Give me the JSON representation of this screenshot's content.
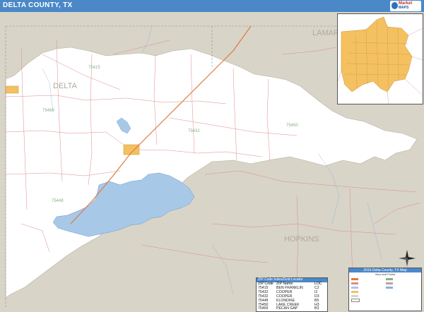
{
  "title": "DELTA COUNTY, TX",
  "logo": {
    "line1": "Market",
    "line2": "MAPS"
  },
  "map_labels": {
    "delta": "DELTA",
    "lamar": "LAMAR",
    "hopkins": "HOPKINS",
    "zip_75415": "75415",
    "zip_75469": "75469",
    "zip_75432": "75432",
    "zip_75450": "75450",
    "zip_75448": "75448"
  },
  "zip_legend": {
    "header": "ZIP Code Index/Grid Locator",
    "columns": [
      "ZIP Code",
      "ZIP Name",
      "LOC"
    ],
    "rows": [
      [
        "75415",
        "BEN FRANKLIN",
        "C2"
      ],
      [
        "75432",
        "COOPER",
        "I2"
      ],
      [
        "75432",
        "COOPER",
        "D3"
      ],
      [
        "75448",
        "KLONDIKE",
        "B5"
      ],
      [
        "75450",
        "LAKE CREEK",
        "H3"
      ],
      [
        "75469",
        "PECAN GAP",
        "B3"
      ]
    ]
  },
  "map_legend": {
    "header": "2016 Delta County, TX Map",
    "subtitle": "View and Points"
  },
  "colors": {
    "title_bar": "#4a88c8",
    "land_outside": "#d8d4c8",
    "county": "#ffffff",
    "water": "#a8c8e8",
    "city": "#f5c060",
    "road": "#e08080",
    "zip_boundary": "#c0a0a0"
  },
  "icons": [
    "compass-rose-icon",
    "market-maps-logo-icon"
  ]
}
